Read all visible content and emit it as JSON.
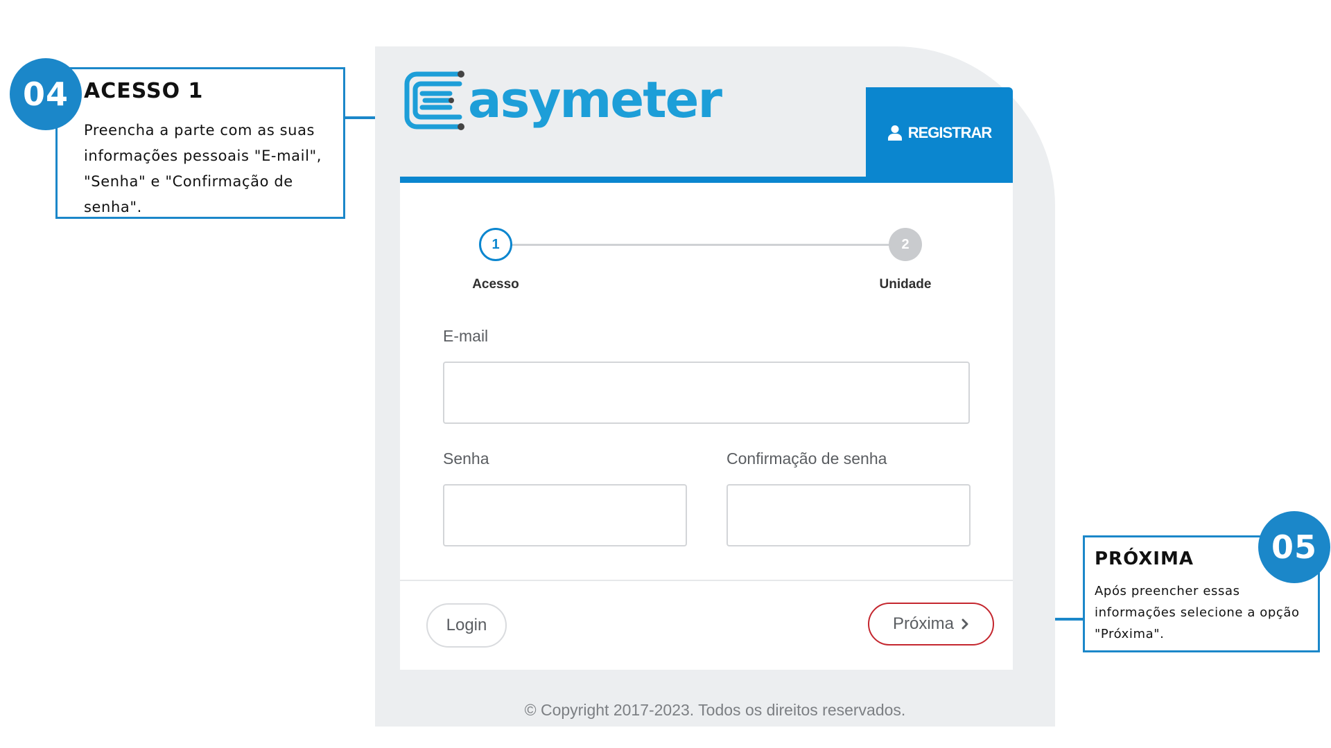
{
  "app": {
    "logo_text": "asymeter",
    "register_label": "REGISTRAR",
    "icon_user": "user-icon"
  },
  "stepper": {
    "steps": [
      {
        "number": "1",
        "label": "Acesso",
        "state": "active"
      },
      {
        "number": "2",
        "label": "Unidade",
        "state": "inactive"
      }
    ]
  },
  "form": {
    "email_label": "E-mail",
    "email_value": "",
    "password_label": "Senha",
    "password_value": "",
    "confirm_label": "Confirmação de senha",
    "confirm_value": ""
  },
  "actions": {
    "login_label": "Login",
    "next_label": "Próxima",
    "next_icon": "chevron-right-icon"
  },
  "footer": {
    "copyright": "© Copyright 2017-2023. Todos os direitos reservados."
  },
  "callouts": [
    {
      "badge": "04",
      "title": "ACESSO 1",
      "text": "Preencha a parte com as suas informações pessoais \"E-mail\", \"Senha\" e \"Confirmação de senha\"."
    },
    {
      "badge": "05",
      "title": "PRÓXIMA",
      "text": "Após preencher essas informações selecione a opção \"Próxima\"."
    }
  ],
  "colors": {
    "brand_blue": "#0b86cf",
    "logo_blue": "#1d9ed8",
    "callout_blue": "#1b87c9",
    "next_border_red": "#c4262e",
    "panel_gray": "#eceef0"
  }
}
